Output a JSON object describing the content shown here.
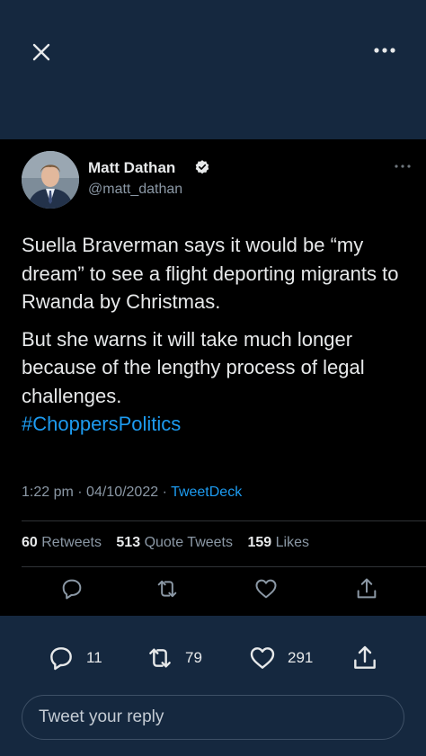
{
  "header": {
    "close_icon": "close-icon",
    "more_icon": "more-horizontal-icon"
  },
  "tweet": {
    "author_name": "Matt Dathan",
    "author_handle": "@matt_dathan",
    "text_paragraph_1": "Suella Braverman says it would be “my dream” to see a flight deporting migrants to Rwanda by Christmas.",
    "text_paragraph_2": "But she warns it will take much longer because of the lengthy process of legal challenges.",
    "hashtag": "#ChoppersPolitics",
    "time": "1:22 pm",
    "date": "04/10/2022",
    "source": "TweetDeck",
    "separator": "·"
  },
  "stats": {
    "retweets_count": "60",
    "retweets_label": "Retweets",
    "quote_count": "513",
    "quote_label": "Quote Tweets",
    "likes_count": "159",
    "likes_label": "Likes"
  },
  "bottom_actions": {
    "reply_count": "11",
    "retweet_count": "79",
    "like_count": "291"
  },
  "reply": {
    "placeholder": "Tweet your reply"
  },
  "colors": {
    "accent": "#1d9bf0",
    "bar_background": "#15283f",
    "card_background": "#000000"
  }
}
